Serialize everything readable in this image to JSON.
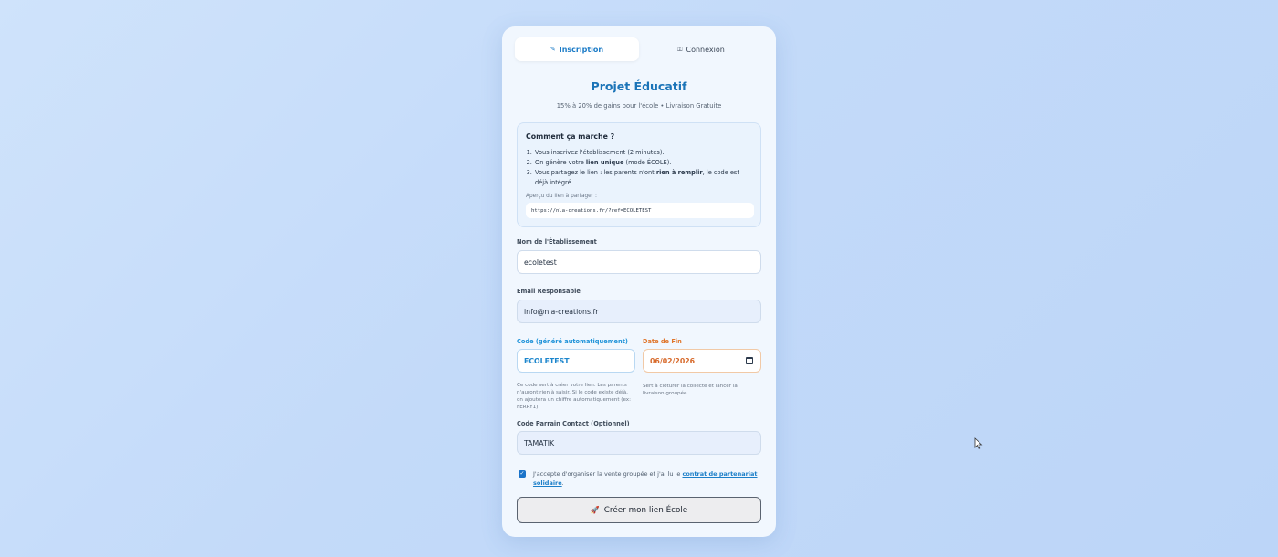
{
  "tabs": [
    {
      "label": "Inscription",
      "icon": "✎",
      "active": true
    },
    {
      "label": "Connexion",
      "icon": "⚿",
      "active": false
    }
  ],
  "title": "Projet Éducatif",
  "subtitle": "15% à 20% de gains pour l'école • Livraison Gratuite",
  "howto": {
    "heading": "Comment ça marche ?",
    "steps": [
      {
        "before": "Vous inscrivez l'établissement (2 minutes).",
        "strong": "",
        "after": ""
      },
      {
        "before": "On génère votre ",
        "strong": "lien unique",
        "after": " (mode ÉCOLE)."
      },
      {
        "before": "Vous partagez le lien : les parents n'ont ",
        "strong": "rien à remplir",
        "after": ", le code est déjà intégré."
      }
    ],
    "preview_label": "Aperçu du lien à partager :",
    "preview_url": "https://nla-creations.fr/?ref=ECOLETEST"
  },
  "form": {
    "school_label": "Nom de l'Établissement",
    "school_value": "ecoletest",
    "email_label": "Email Responsable",
    "email_value": "info@nla-creations.fr",
    "code_label": "Code (généré automatiquement)",
    "code_value": "ECOLETEST",
    "code_help": "Ce code sert à créer votre lien. Les parents n'auront rien à saisir. Si le code existe déjà, on ajoutera un chiffre automatiquement (ex: FERRY1).",
    "date_label": "Date de Fin",
    "date_value": "06/02/2026",
    "date_help": "Sert à clôturer la collecte et lancer la livraison groupée.",
    "sponsor_label": "Code Parrain Contact (Optionnel)",
    "sponsor_value": "TAMATIK"
  },
  "consent": {
    "checked": true,
    "text": "J'accepte d'organiser la vente groupée et j'ai lu le ",
    "link": "contrat de partenariat solidaire",
    "end": "."
  },
  "submit": {
    "icon": "🚀",
    "label": "Créer mon lien École"
  },
  "colors": {
    "accent": "#1b74b8",
    "checkbox": "#1a73c9",
    "date": "#e0762c"
  }
}
